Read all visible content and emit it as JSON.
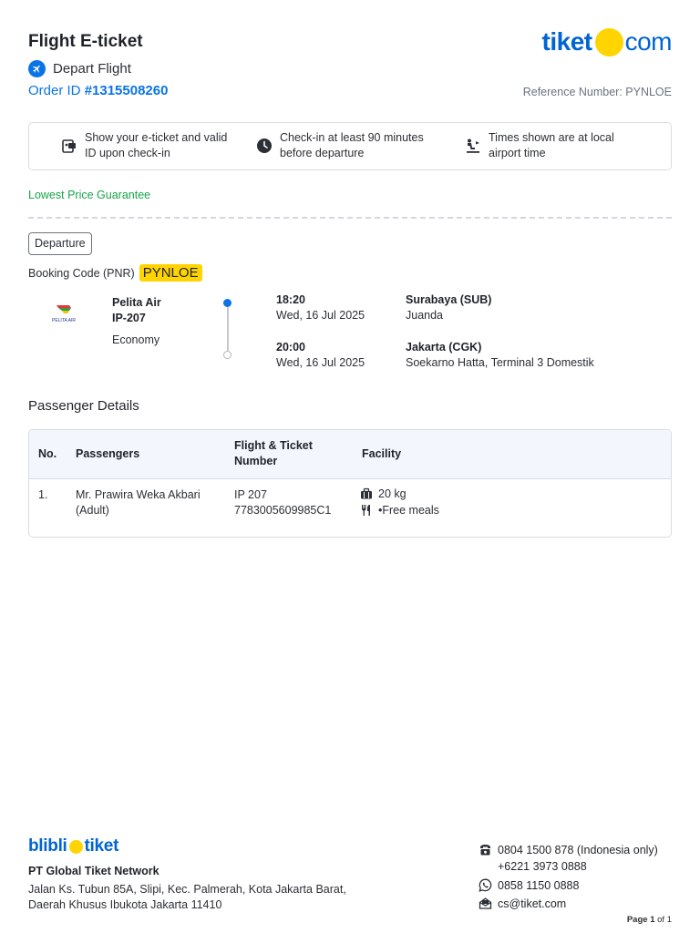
{
  "header": {
    "title": "Flight E-ticket",
    "brand_left": "tiket",
    "brand_right": "com",
    "depart_label": "Depart Flight",
    "order_id_label": "Order ID",
    "order_id": "#1315508260",
    "reference_number": "Reference Number: PYNLOE"
  },
  "info": [
    {
      "icon": "ticket-id-icon",
      "line1": "Show your e-ticket and valid",
      "line2": "ID upon check-in"
    },
    {
      "icon": "clock-icon",
      "line1": "Check-in at least 90 minutes",
      "line2": "before departure"
    },
    {
      "icon": "airport-time-icon",
      "line1": "Times shown are at local",
      "line2": "airport time"
    }
  ],
  "lowest_price": "Lowest Price Guarantee",
  "segment": {
    "badge": "Departure",
    "pnr_label": "Booking Code (PNR)",
    "pnr": "PYNLOE",
    "airline_logo_text": "PELITA AIR",
    "airline": "Pelita Air",
    "flight_no": "IP-207",
    "cabin": "Economy",
    "depart": {
      "time": "18:20",
      "date": "Wed, 16 Jul 2025",
      "city": "Surabaya (SUB)",
      "airport": "Juanda"
    },
    "arrive": {
      "time": "20:00",
      "date": "Wed, 16 Jul 2025",
      "city": "Jakarta (CGK)",
      "airport": "Soekarno Hatta, Terminal 3 Domestik"
    }
  },
  "passengers": {
    "title": "Passenger Details",
    "columns": {
      "no": "No.",
      "passengers": "Passengers",
      "ticket_line1": "Flight & Ticket",
      "ticket_line2": "Number",
      "facility": "Facility"
    },
    "rows": [
      {
        "no": "1.",
        "name": "Mr. Prawira Weka Akbari",
        "type": "(Adult)",
        "flight": "IP 207",
        "ticket": "7783005609985C1",
        "baggage": "20 kg",
        "meal": "•Free meals"
      }
    ]
  },
  "footer": {
    "brand_left": "blibli",
    "brand_right": "tiket",
    "company": "PT Global Tiket Network",
    "address_line1": "Jalan Ks. Tubun 85A, Slipi, Kec. Palmerah, Kota Jakarta Barat,",
    "address_line2": "Daerah Khusus Ibukota Jakarta 11410",
    "phone1": "0804 1500 878 (Indonesia only)",
    "phone2": "+6221 3973 0888",
    "whatsapp": "0858 1150 0888",
    "email": "cs@tiket.com",
    "page_label": "Page",
    "page_current": "1",
    "page_total": "of 1"
  },
  "colors": {
    "accent": "#0a74e6",
    "brand_blue": "#0064d2",
    "brand_yellow": "#ffd400",
    "guarantee_green": "#17a34a"
  }
}
